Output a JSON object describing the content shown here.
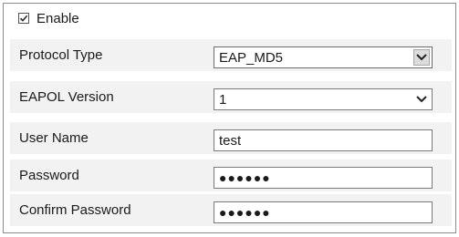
{
  "enable": {
    "label": "Enable",
    "checked": true,
    "check_glyph": "✓"
  },
  "protocol_type": {
    "label": "Protocol Type",
    "value": "EAP_MD5"
  },
  "eapol_version": {
    "label": "EAPOL Version",
    "value": "1"
  },
  "user_name": {
    "label": "User Name",
    "value": "test"
  },
  "password": {
    "label": "Password",
    "masked": "●●●●●●"
  },
  "confirm_password": {
    "label": "Confirm Password",
    "masked": "●●●●●●"
  },
  "icons": {
    "dropdown": "chevron-down-icon",
    "checkbox": "checkmark-icon"
  }
}
